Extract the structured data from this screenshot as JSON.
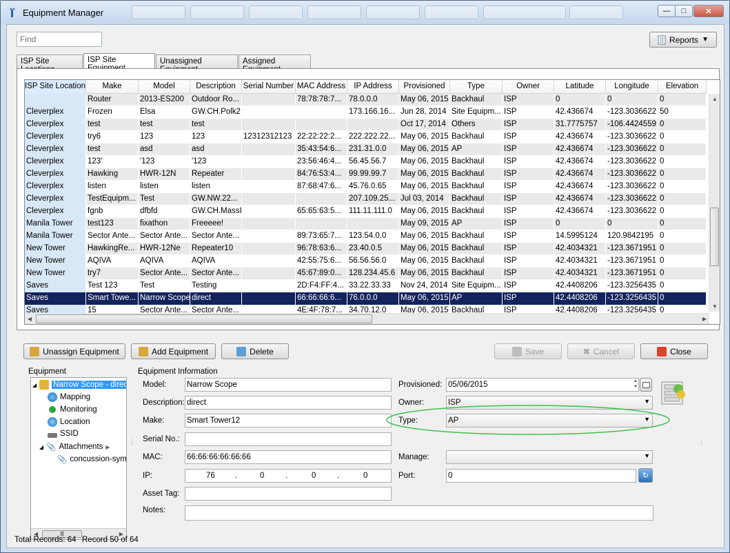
{
  "window": {
    "title": "Equipment Manager"
  },
  "find": {
    "placeholder": "Find"
  },
  "reports_label": "Reports",
  "tabs": [
    "ISP Site Locations",
    "ISP Site Equipment",
    "Unassigned Equipment",
    "Assigned Equipment"
  ],
  "active_tab": 1,
  "grid": {
    "columns": [
      "ISP Site Location",
      "Make",
      "Model",
      "Description",
      "Serial Number",
      "MAC Address",
      "IP Address",
      "Provisioned",
      "Type",
      "Owner",
      "Latitude",
      "Longitude",
      "Elevation"
    ],
    "rows": [
      [
        "",
        "Router",
        "2013-ES200",
        "Outdoor Ro...",
        "",
        "78:78:78:7...",
        "78.0.0.0",
        "May 06, 2015",
        "Backhaul",
        "ISP",
        "0",
        "0",
        "0"
      ],
      [
        "Cleverplex",
        "Frozen",
        "Elsa",
        "GW.CH.Polk2",
        "",
        "",
        "173.166.16...",
        "Jun 28, 2014",
        "Site Equipm...",
        "ISP",
        "42.436674",
        "-123.3036622",
        "50"
      ],
      [
        "Cleverplex",
        "test",
        "test",
        "test",
        "",
        "",
        "",
        "Oct 17, 2014",
        "Others",
        "ISP",
        "31.7775757",
        "-106.4424559",
        "0"
      ],
      [
        "Cleverplex",
        "try6",
        "123",
        "123",
        "12312312123",
        "22:22:22:2...",
        "222.222.22...",
        "May 06, 2015",
        "Backhaul",
        "ISP",
        "42.436674",
        "-123.3036622",
        "0"
      ],
      [
        "Cleverplex",
        "test",
        "asd",
        "asd",
        "",
        "35:43:54:6...",
        "231.31.0.0",
        "May 06, 2015",
        "AP",
        "ISP",
        "42.436674",
        "-123.3036622",
        "0"
      ],
      [
        "Cleverplex",
        "123'",
        "'123",
        "'123",
        "",
        "23:56:46:4...",
        "56.45.56.7",
        "May 06, 2015",
        "Backhaul",
        "ISP",
        "42.436674",
        "-123.3036622",
        "0"
      ],
      [
        "Cleverplex",
        "Hawking",
        "HWR-12N",
        "Repeater",
        "",
        "84:76:53:4...",
        "99.99.99.7",
        "May 06, 2015",
        "Backhaul",
        "ISP",
        "42.436674",
        "-123.3036622",
        "0"
      ],
      [
        "Cleverplex",
        "listen",
        "listen",
        "listen",
        "",
        "87:68:47:6...",
        "45.76.0.65",
        "May 06, 2015",
        "Backhaul",
        "ISP",
        "42.436674",
        "-123.3036622",
        "0"
      ],
      [
        "Cleverplex",
        "TestEquipm...",
        "Test",
        "GW.NW.22...",
        "",
        "",
        "207.109.25...",
        "Jul 03, 2014",
        "Backhaul",
        "ISP",
        "42.436674",
        "-123.3036622",
        "0"
      ],
      [
        "Cleverplex",
        "fgnb",
        "dfbfd",
        "GW.CH.MassI",
        "",
        "65:65:63:5...",
        "111.11.111.0",
        "May 06, 2015",
        "Backhaul",
        "ISP",
        "42.436674",
        "-123.3036622",
        "0"
      ],
      [
        "Manila Tower",
        "test123",
        "fixathon",
        "Freeeee!",
        "",
        "",
        "",
        "May 09, 2015",
        "AP",
        "ISP",
        "0",
        "0",
        "0"
      ],
      [
        "Manila Tower",
        "Sector Ante...",
        "Sector Ante...",
        "Sector Ante...",
        "",
        "89:73:65:7...",
        "123.54.0.0",
        "May 06, 2015",
        "Backhaul",
        "ISP",
        "14.5995124",
        "120.9842195",
        "0"
      ],
      [
        "New Tower",
        "HawkingRe...",
        "HWR-12Ne",
        "Repeater10",
        "",
        "96:78:63:6...",
        "23.40.0.5",
        "May 06, 2015",
        "Backhaul",
        "ISP",
        "42.4034321",
        "-123.3671951",
        "0"
      ],
      [
        "New Tower",
        "AQIVA",
        "AQIVA",
        "AQIVA",
        "",
        "42:55:75:6...",
        "56.56.56.0",
        "May 06, 2015",
        "Backhaul",
        "ISP",
        "42.4034321",
        "-123.3671951",
        "0"
      ],
      [
        "New Tower",
        "try7",
        "Sector Ante...",
        "Sector Ante...",
        "",
        "45:67:89:0...",
        "128.234.45.6",
        "May 06, 2015",
        "Backhaul",
        "ISP",
        "42.4034321",
        "-123.3671951",
        "0"
      ],
      [
        "Saves",
        "Test 123",
        "Test",
        "Testing",
        "",
        "2D:F4:FF:4...",
        "33.22.33.33",
        "Nov 24, 2014",
        "Site Equipm...",
        "ISP",
        "42.4408206",
        "-123.3256435",
        "0"
      ],
      [
        "Saves",
        "Smart Towe...",
        "Narrow Scope",
        "direct",
        "",
        "66:66:66:6...",
        "76.0.0.0",
        "May 06, 2015",
        "AP",
        "ISP",
        "42.4408206",
        "-123.3256435",
        "0"
      ],
      [
        "Saves",
        "15",
        "Sector Ante...",
        "Sector Ante...",
        "",
        "4E:4F:78:7...",
        "34.70.12.0",
        "May 06, 2015",
        "Backhaul",
        "ISP",
        "42.4408206",
        "-123.3256435",
        "0"
      ]
    ],
    "selected_row": 16
  },
  "actions": {
    "unassign": "Unassign Equipment",
    "add": "Add Equipment",
    "delete": "Delete",
    "save": "Save",
    "cancel": "Cancel",
    "close": "Close"
  },
  "equipment_tree": {
    "label": "Equipment",
    "root": "Narrow Scope - direct",
    "children": [
      "Mapping",
      "Monitoring",
      "Location",
      "SSID",
      "Attachments"
    ],
    "attachment": "concussion-sym"
  },
  "info": {
    "label": "Equipment Information",
    "model_label": "Model:",
    "model": "Narrow Scope",
    "description_label": "Description:",
    "description": "direct",
    "make_label": "Make:",
    "make": "Smart Tower12",
    "serial_label": "Serial No.:",
    "serial": "",
    "mac_label": "MAC:",
    "mac": "66:66:66:66:66:66",
    "ip_label": "IP:",
    "ip": [
      "76",
      "0",
      "0",
      "0"
    ],
    "asset_label": "Asset Tag:",
    "asset": "",
    "notes_label": "Notes:",
    "notes": "",
    "provisioned_label": "Provisioned:",
    "provisioned": "05/06/2015",
    "owner_label": "Owner:",
    "owner": "ISP",
    "type_label": "Type:",
    "type": "AP",
    "manage_label": "Manage:",
    "manage": "",
    "port_label": "Port:",
    "port": "0"
  },
  "status": {
    "total": "Total Records: 64",
    "record": "Record 50 of 64"
  },
  "colors": {
    "selection": "#13235c",
    "highlight_ellipse": "#3cc24b",
    "location_column": "#d8e8f6"
  }
}
